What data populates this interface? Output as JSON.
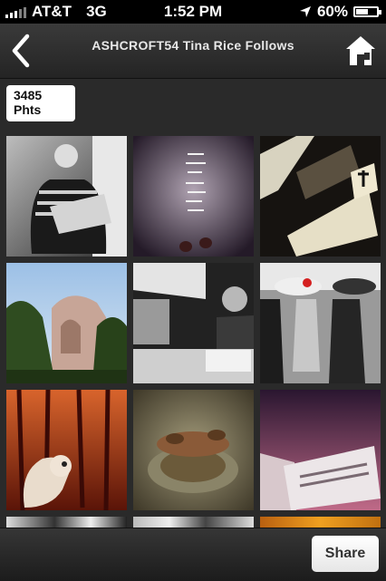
{
  "status_bar": {
    "carrier": "AT&T",
    "network": "3G",
    "time": "1:52 PM",
    "battery": "60%",
    "battery_level": 0.6,
    "icons": [
      "signal-bars-icon",
      "location-arrow-icon",
      "battery-icon"
    ]
  },
  "nav": {
    "title": "ASHCROFT54 Tina Rice Follows",
    "back_icon": "chevron-left-icon",
    "home_icon": "home-icon"
  },
  "badge": {
    "count": "3485",
    "unit": "Phts"
  },
  "photos": [
    {
      "name": "photo-woman-reading",
      "colors": [
        "#c9c9c9",
        "#2b2b2b"
      ]
    },
    {
      "name": "photo-sidewalk-text",
      "colors": [
        "#8a7888",
        "#2a2030"
      ]
    },
    {
      "name": "photo-chinatown-signs",
      "colors": [
        "#d8d0b8",
        "#1f1a15"
      ]
    },
    {
      "name": "photo-building-trees",
      "colors": [
        "#8ab0d8",
        "#2e4a22"
      ]
    },
    {
      "name": "photo-man-at-counter",
      "colors": [
        "#d0d0d0",
        "#222222"
      ]
    },
    {
      "name": "photo-street-umbrellas",
      "colors": [
        "#c0c0c0",
        "#202020"
      ]
    },
    {
      "name": "photo-dog-red-forest",
      "colors": [
        "#c84a20",
        "#3a0c08"
      ]
    },
    {
      "name": "photo-rusty-hydrant",
      "colors": [
        "#8a8466",
        "#4a4430"
      ]
    },
    {
      "name": "photo-photographer-magazine",
      "colors": [
        "#b0607a",
        "#301828"
      ]
    }
  ],
  "toolbar": {
    "share_label": "Share"
  }
}
